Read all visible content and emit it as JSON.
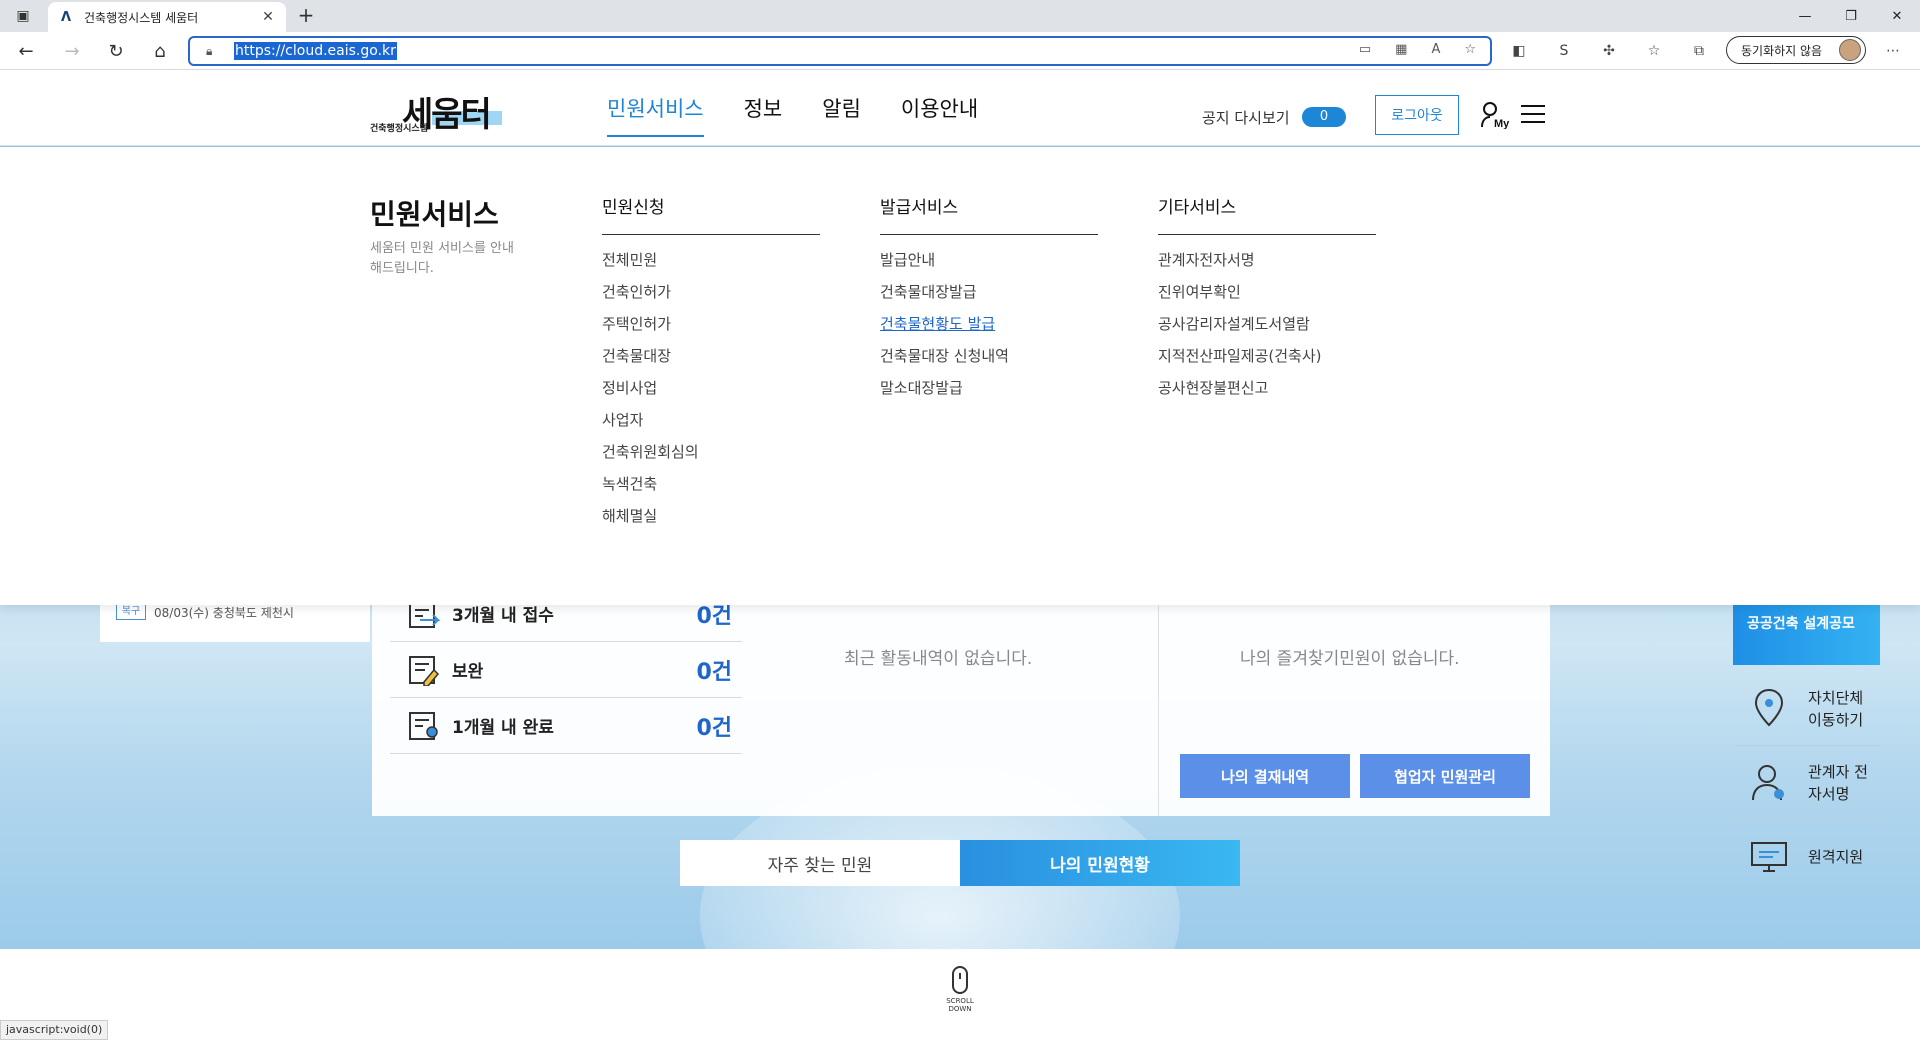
{
  "browser": {
    "tab_title": "건축행정시스템 세움터",
    "url": "https://cloud.eais.go.kr",
    "sync_label": "동기화하지 않음"
  },
  "header": {
    "logo_main": "세움터",
    "logo_sub": "건축행정시스템",
    "nav": [
      "민원서비스",
      "정보",
      "알림",
      "이용안내"
    ],
    "notice_label": "공지 다시보기",
    "notice_count": "0",
    "logout_label": "로그아웃",
    "my_label": "My"
  },
  "megamenu": {
    "title": "민원서비스",
    "description": "세움터 민원 서비스를 안내해드립니다.",
    "columns": [
      {
        "heading": "민원신청",
        "links": [
          "전체민원",
          "건축인허가",
          "주택인허가",
          "건축물대장",
          "정비사업",
          "사업자",
          "건축위원회심의",
          "녹색건축",
          "해체멸실"
        ]
      },
      {
        "heading": "발급서비스",
        "links": [
          "발급안내",
          "건축물대장발급",
          "건축물현황도 발급",
          "건축물대장 신청내역",
          "말소대장발급"
        ]
      },
      {
        "heading": "기타서비스",
        "links": [
          "관계자전자서명",
          "진위여부확인",
          "공사감리자설계도서열람",
          "지적전산파일제공(건축사)",
          "공사현장불편신고"
        ]
      }
    ],
    "hovered_link": "건축물현황도 발급"
  },
  "main": {
    "notice_tag": "복구",
    "notice_text": "08/03(수) 충청북도 제천시",
    "stats": [
      {
        "label": "3개월 내 접수",
        "value": "0건"
      },
      {
        "label": "보완",
        "value": "0건"
      },
      {
        "label": "1개월 내 완료",
        "value": "0건"
      }
    ],
    "empty_recent": "최근 활동내역이 없습니다.",
    "empty_favorites": "나의 즐겨찾기민원이 없습니다.",
    "btn_payment": "나의 결재내역",
    "btn_partner": "협업자 민원관리",
    "seg_frequent": "자주 찾는 민원",
    "seg_status": "나의 민원현황"
  },
  "side": {
    "banner": "공공건축 설계공모",
    "items": [
      "자치단체 이동하기",
      "관계자 전자서명",
      "원격지원"
    ]
  },
  "footer": {
    "scroll_label": "SCROLL DOWN",
    "status_url": "javascript:void(0)"
  },
  "colors": {
    "accent": "#1e86d6",
    "link_hover": "#1e66c9",
    "button_blue": "#5b8fe8"
  }
}
